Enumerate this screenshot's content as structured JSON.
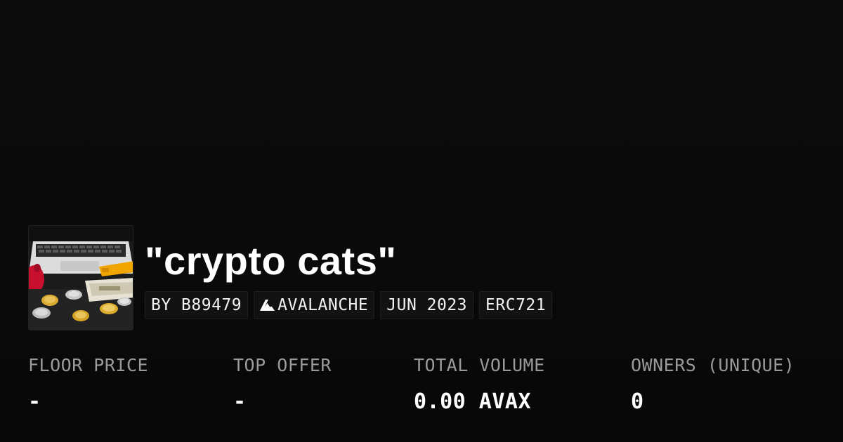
{
  "collection": {
    "title": "\"crypto cats\"",
    "tags": {
      "creator": "BY B89479",
      "chain": "AVALANCHE",
      "chain_icon": "avalanche-icon",
      "date": "JUN 2023",
      "standard": "ERC721"
    },
    "thumbnail_icon": "collection-thumbnail-image"
  },
  "stats": {
    "floor_price": {
      "label": "FLOOR PRICE",
      "value": "-"
    },
    "top_offer": {
      "label": "TOP OFFER",
      "value": "-"
    },
    "total_volume": {
      "label": "TOTAL VOLUME",
      "value": "0.00 AVAX"
    },
    "owners": {
      "label": "OWNERS (UNIQUE)",
      "value": "0"
    }
  },
  "colors": {
    "background": "#0a0a0a",
    "text": "#ffffff",
    "muted": "#9a9a9a",
    "tag_bg": "#121212"
  }
}
